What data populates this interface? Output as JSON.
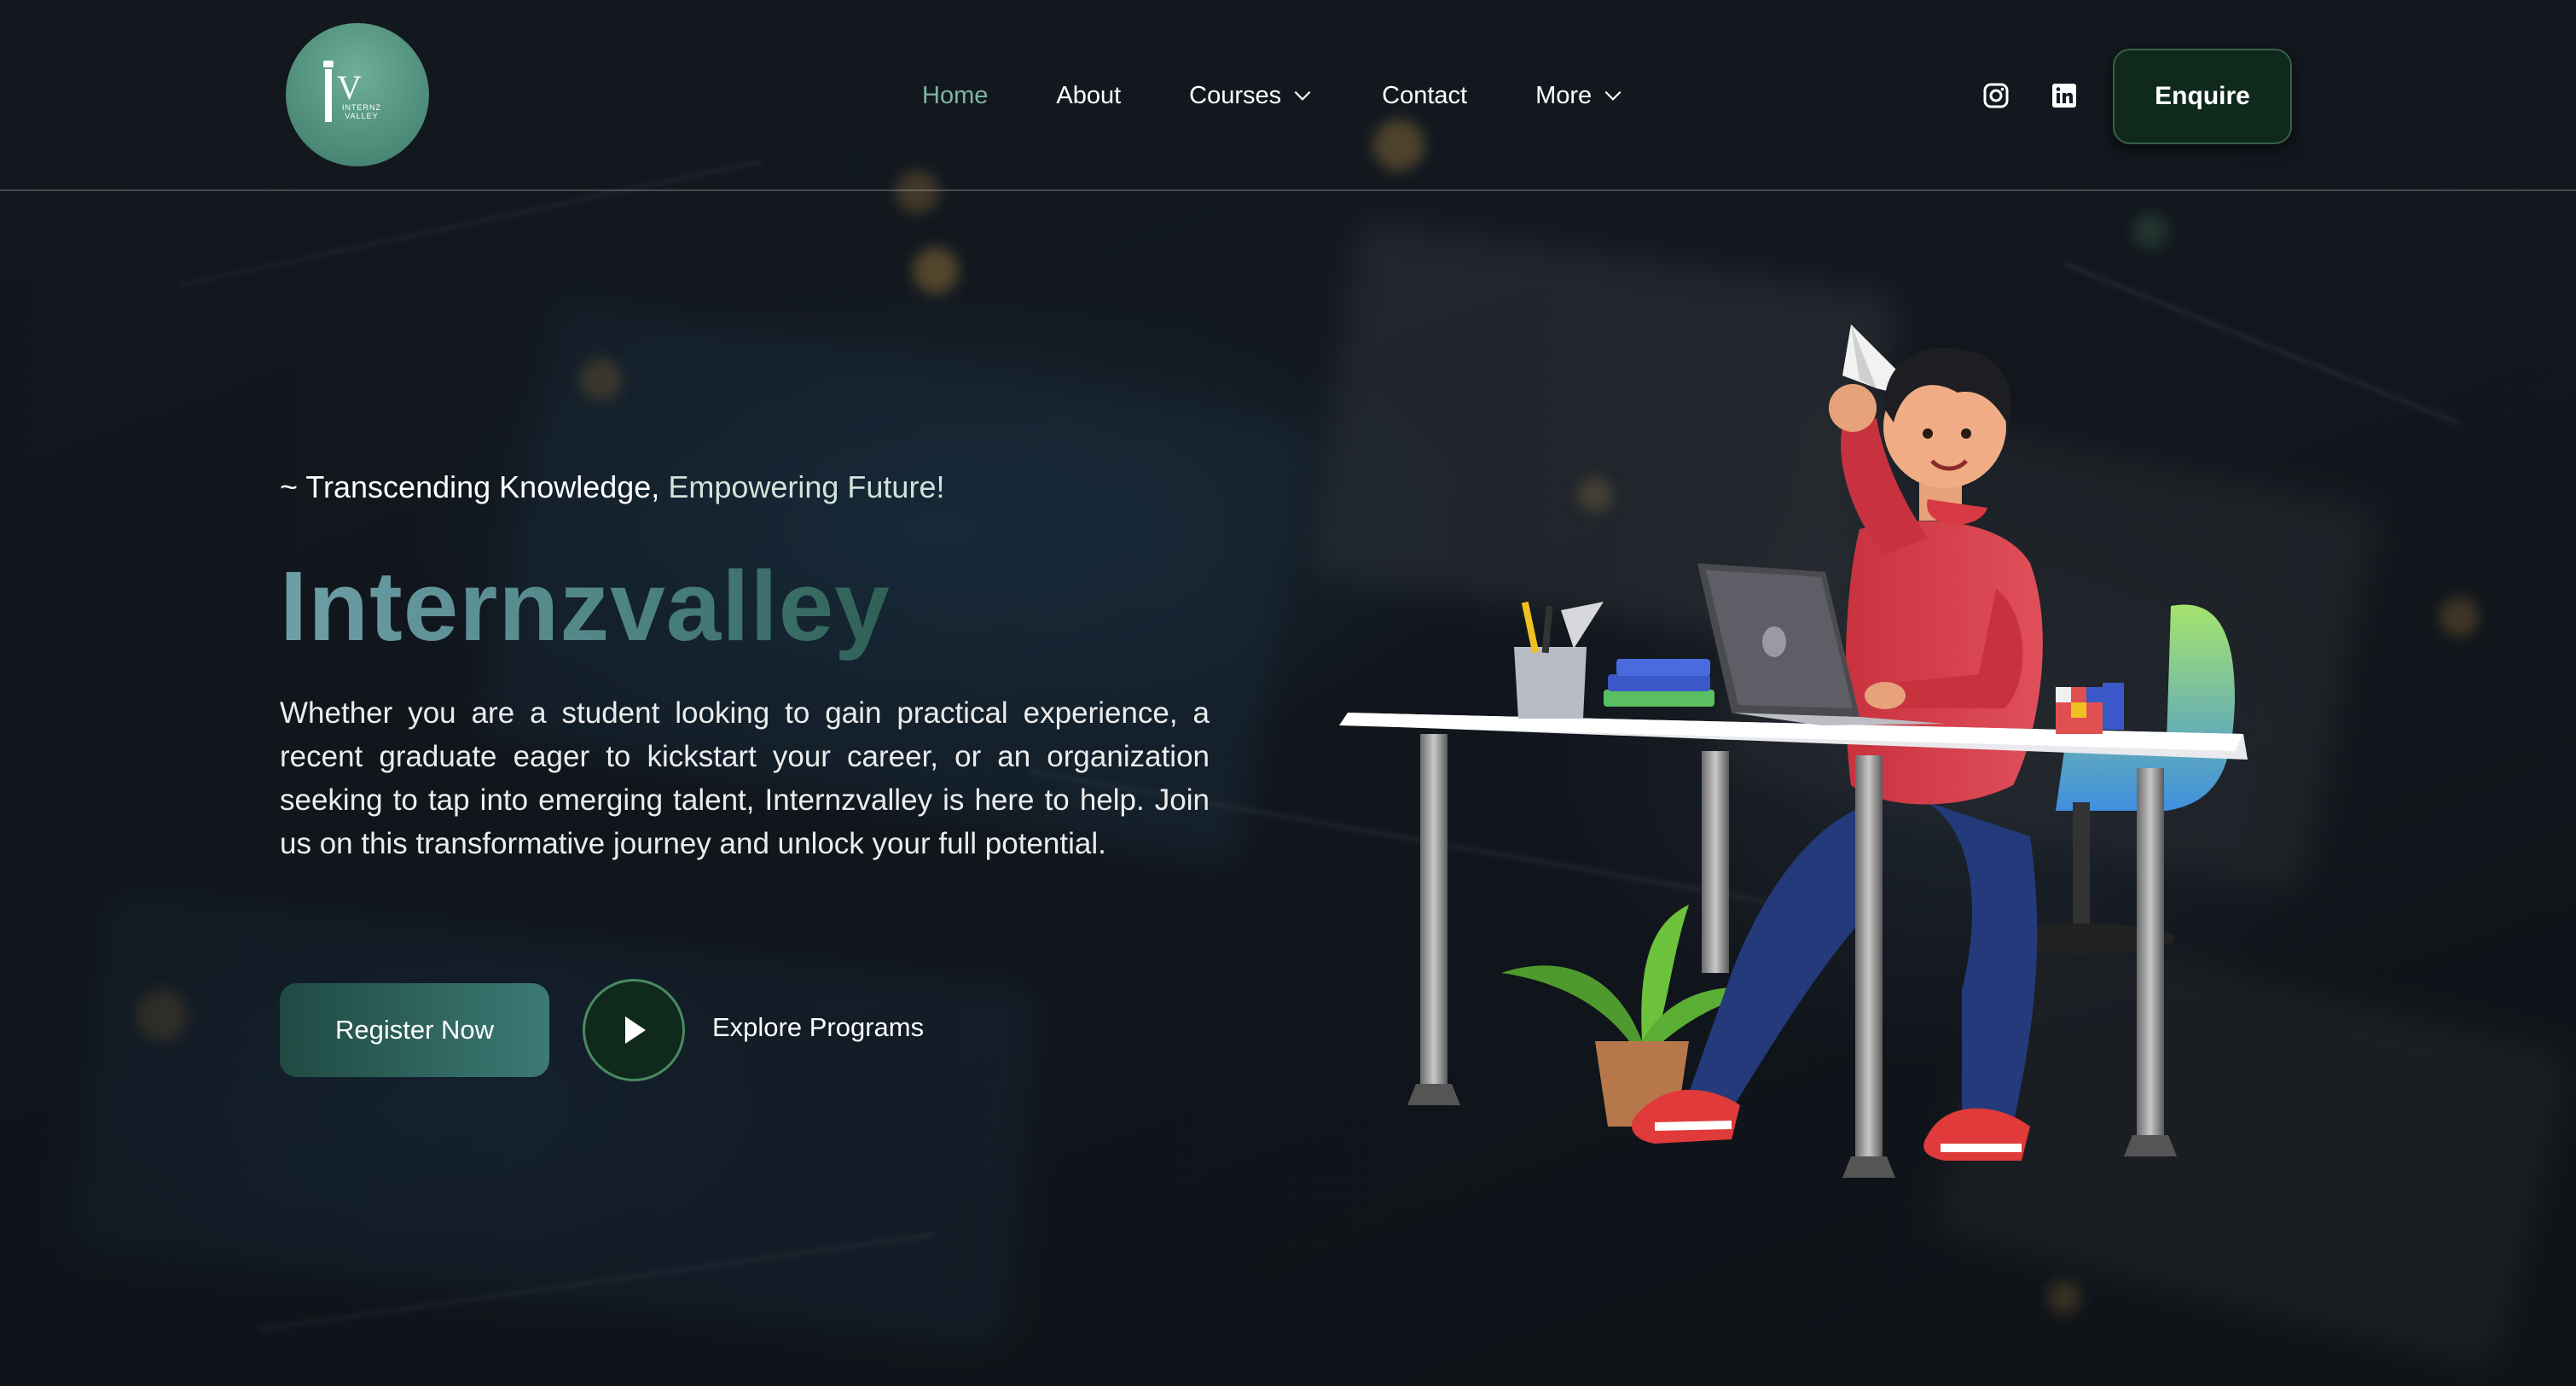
{
  "brand": {
    "logo_text": "INTERNZ VALLEY",
    "logo_mark": "iV"
  },
  "nav": {
    "items": [
      {
        "label": "Home",
        "active": true,
        "dropdown": false
      },
      {
        "label": "About",
        "active": false,
        "dropdown": false
      },
      {
        "label": "Courses",
        "active": false,
        "dropdown": true
      },
      {
        "label": "Contact",
        "active": false,
        "dropdown": false
      },
      {
        "label": "More",
        "active": false,
        "dropdown": true
      }
    ],
    "social_icons": [
      "instagram-icon",
      "linkedin-icon"
    ],
    "enquire_label": "Enquire"
  },
  "hero": {
    "tagline_prefix": "~ Transcending Knowledge,",
    "tagline_highlight": "Empowering Future!",
    "title": "Internzvalley",
    "description": "Whether you are a student looking to gain practical experience, a recent graduate eager to kickstart your career, or an organization seeking to tap into emerging talent, Internzvalley is here to help. Join us on this transformative journey and unlock your full potential.",
    "register_label": "Register Now",
    "explore_label": "Explore Programs"
  },
  "colors": {
    "accent": "#7fb4a2",
    "enquire_bg": "#10291d",
    "register_gradient_start": "#1f4a43",
    "register_gradient_end": "#3d7a74",
    "title_gradient_start": "#6e9fa8",
    "title_gradient_end": "#2f5f55"
  }
}
